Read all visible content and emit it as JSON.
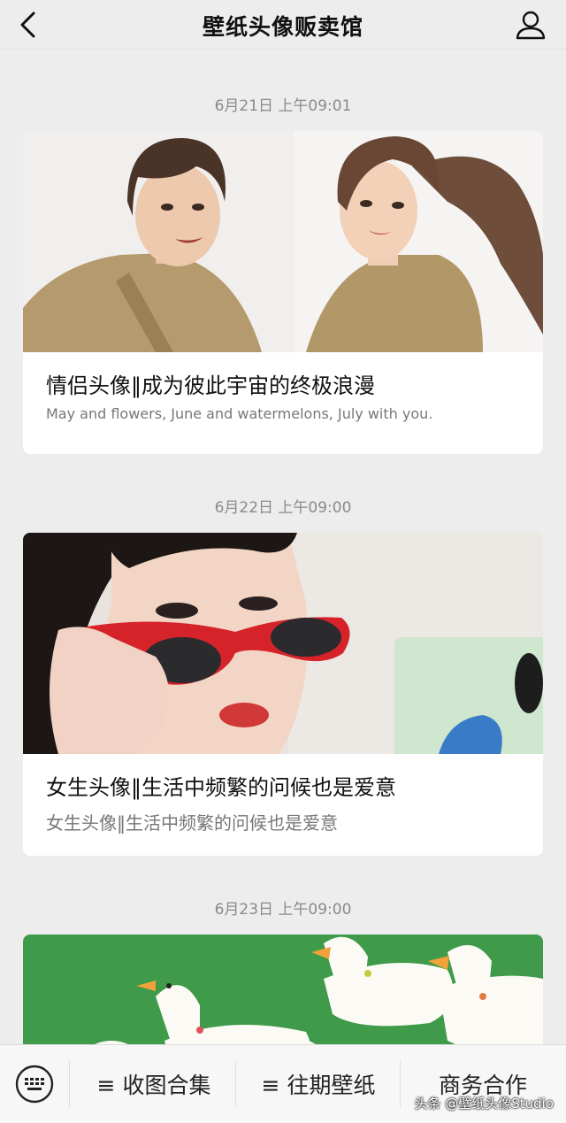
{
  "header": {
    "title": "壁纸头像贩卖馆"
  },
  "posts": [
    {
      "timestamp": "6月21日 上午09:01",
      "title": "情侣头像‖成为彼此宇宙的终极浪漫",
      "subtitle": "May and flowers, June and watermelons, July with you."
    },
    {
      "timestamp": "6月22日 上午09:00",
      "title": "女生头像‖生活中频繁的问候也是爱意",
      "subtitle": "女生头像‖生活中频繁的问候也是爱意"
    },
    {
      "timestamp": "6月23日 上午09:00"
    }
  ],
  "bottom_menu": {
    "items": [
      "≡ 收图合集",
      "≡ 往期壁纸",
      "商务合作"
    ]
  },
  "watermark": "头条 @壁纸头像Studio",
  "colors": {
    "background": "#ededed",
    "card": "#ffffff",
    "timestamp_text": "#8a8a8a",
    "duck_background": "#3f9a4a",
    "sunglasses": "#d6232a"
  },
  "icons": {
    "back": "chevron-left-icon",
    "profile": "person-icon",
    "keyboard": "keyboard-icon"
  }
}
